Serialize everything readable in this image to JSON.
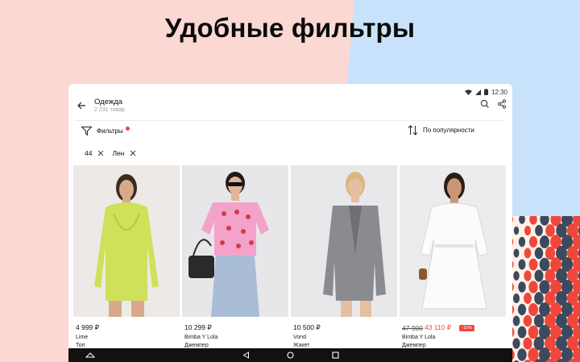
{
  "promo": {
    "title": "Удобные фильтры"
  },
  "status_bar": {
    "time": "12:30"
  },
  "header": {
    "title": "Одежда",
    "subtitle": "2 231 товар"
  },
  "toolbar": {
    "filters_label": "Фильтры",
    "sort_label": "По популярности"
  },
  "chips": [
    {
      "label": "44"
    },
    {
      "label": "Лен"
    }
  ],
  "products": [
    {
      "price": "4 999 ₽",
      "brand": "Lime",
      "category": "Топ"
    },
    {
      "price": "10 299 ₽",
      "brand": "Bimba Y Lola",
      "category": "Джемпер"
    },
    {
      "price": "10 500 ₽",
      "brand": "Vond",
      "category": "Жакет"
    },
    {
      "old_price": "47 900",
      "price": "43 110 ₽",
      "discount": "-15%",
      "brand": "Bimba Y Lola",
      "category": "Джемпер"
    }
  ],
  "colors": {
    "accent": "#f0473c",
    "promo_pink": "#fcd8d4",
    "promo_blue": "#c9e2fb"
  },
  "icons": [
    "back-arrow-icon",
    "search-icon",
    "share-icon",
    "filter-icon",
    "sort-icon",
    "close-icon",
    "wifi-icon",
    "signal-icon",
    "battery-icon",
    "nav-back-icon",
    "nav-home-icon",
    "nav-recents-icon",
    "nav-collapse-icon"
  ]
}
